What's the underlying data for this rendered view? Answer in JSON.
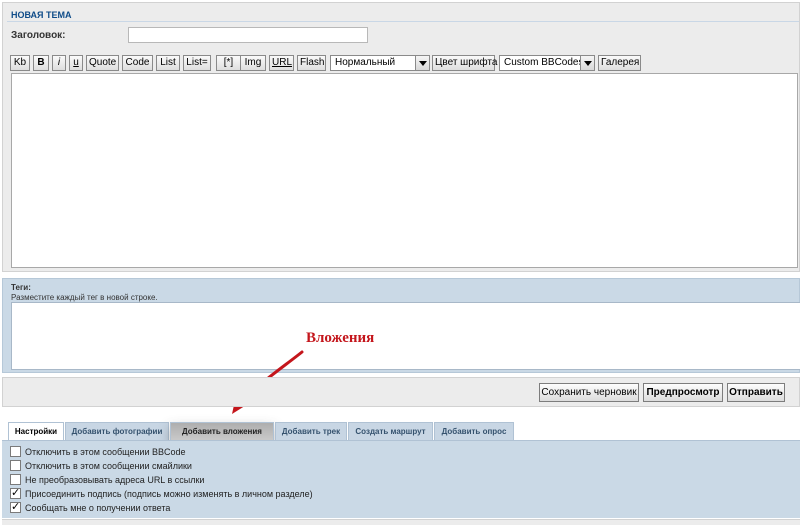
{
  "header": {
    "title": "НОВАЯ ТЕМА"
  },
  "subject": {
    "label": "Заголовок:",
    "value": ""
  },
  "toolbar": {
    "kb": "Kb",
    "bold": "B",
    "italic": "i",
    "underline": "u",
    "quote": "Quote",
    "code": "Code",
    "list": "List",
    "list_eq": "List=",
    "list_item": "[*]",
    "img": "Img",
    "url": "URL",
    "flash": "Flash",
    "font_size": "Нормальный",
    "font_color": "Цвет шрифта",
    "custom_bbcodes": "Custom BBCodes",
    "gallery": "Галерея"
  },
  "tags": {
    "label": "Теги:",
    "hint": "Разместите каждый тег в новой строке."
  },
  "annotation": {
    "label": "Вложения"
  },
  "actions": {
    "save_draft": "Сохранить черновик",
    "preview": "Предпросмотр",
    "submit": "Отправить"
  },
  "tabs": [
    {
      "label": "Настройки",
      "active": true
    },
    {
      "label": "Добавить фотографии"
    },
    {
      "label": "Добавить вложения",
      "highlighted": true
    },
    {
      "label": "Добавить трек"
    },
    {
      "label": "Создать маршрут"
    },
    {
      "label": "Добавить опрос"
    }
  ],
  "options": [
    {
      "label": "Отключить в этом сообщении BBCode",
      "checked": false
    },
    {
      "label": "Отключить в этом сообщении смайлики",
      "checked": false
    },
    {
      "label": "Не преобразовывать адреса URL в ссылки",
      "checked": false
    },
    {
      "label": "Присоединить подпись (подпись можно изменять в личном разделе)",
      "checked": true
    },
    {
      "label": "Сообщать мне о получении ответа",
      "checked": true
    }
  ],
  "colors": {
    "accent_title": "#0f4c89",
    "panel_blue": "#cad9e6",
    "annotation_red": "#c4161c"
  }
}
